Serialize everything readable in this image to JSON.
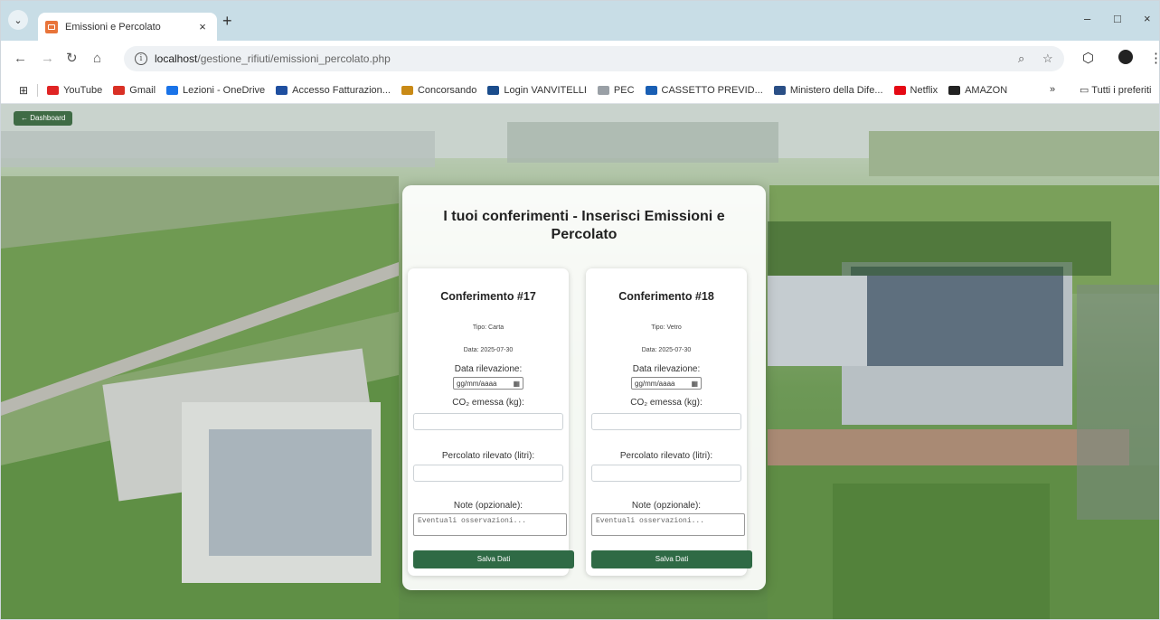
{
  "browser": {
    "tab_title": "Emissioni e Percolato",
    "tab_close": "×",
    "new_tab": "+",
    "url_host": "localhost",
    "url_path": "/gestione_rifiuti/emissioni_percolato.php",
    "window_minimize": "–",
    "window_restore": "□",
    "window_close": "×"
  },
  "bookmarks": {
    "items": [
      {
        "label": "YouTube",
        "color": "#e02424"
      },
      {
        "label": "Gmail",
        "color": "#d93025"
      },
      {
        "label": "Lezioni - OneDrive",
        "color": "#1a73e8"
      },
      {
        "label": "Accesso Fatturazion...",
        "color": "#1f4fa0"
      },
      {
        "label": "Concorsando",
        "color": "#c98a16"
      },
      {
        "label": "Login VANVITELLI",
        "color": "#1b4d8c"
      },
      {
        "label": "PEC",
        "color": "#9aa0a6"
      },
      {
        "label": "CASSETTO PREVID...",
        "color": "#1a5fb4"
      },
      {
        "label": "Ministero della Dife...",
        "color": "#2a4f86"
      },
      {
        "label": "Netflix",
        "color": "#e50914"
      },
      {
        "label": "AMAZON",
        "color": "#222222"
      }
    ],
    "overflow": "»",
    "all_bookmarks": "Tutti i preferiti"
  },
  "page": {
    "dashboard_button": "← Dashboard",
    "title": "I tuoi conferimenti - Inserisci Emissioni e Percolato",
    "entries": [
      {
        "heading": "Conferimento #17",
        "tipo": "Tipo: Carta",
        "data": "Data: 2025-07-30",
        "data_label": "Data rilevazione:",
        "date_value": "gg/mm/aaaa",
        "co2_label": "CO₂ emessa (kg):",
        "percolato_label": "Percolato rilevato (litri):",
        "note_label": "Note (opzionale):",
        "note_placeholder": "Eventuali osservazioni...",
        "save_label": "Salva Dati"
      },
      {
        "heading": "Conferimento #18",
        "tipo": "Tipo: Vetro",
        "data": "Data: 2025-07-30",
        "data_label": "Data rilevazione:",
        "date_value": "gg/mm/aaaa",
        "co2_label": "CO₂ emessa (kg):",
        "percolato_label": "Percolato rilevato (litri):",
        "note_label": "Note (opzionale):",
        "note_placeholder": "Eventuali osservazioni...",
        "save_label": "Salva Dati"
      }
    ]
  }
}
